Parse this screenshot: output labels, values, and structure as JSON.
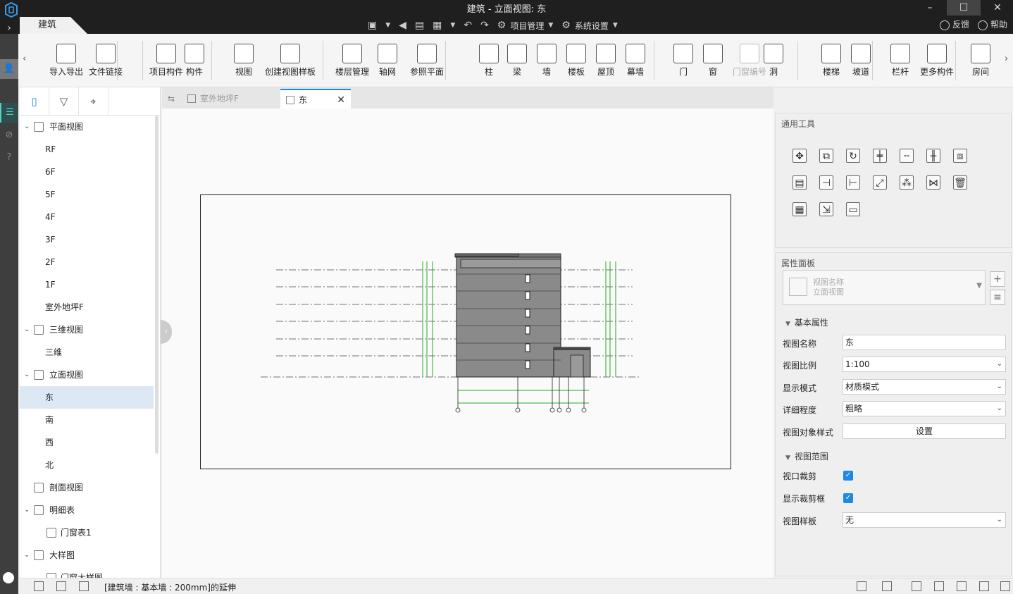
{
  "window": {
    "title": "建筑 - 立面视图: 东",
    "active_tab": "建筑",
    "controls": {
      "minimize": "–",
      "maximize": "☐",
      "close": "✕"
    }
  },
  "quick_access": {
    "project_mgmt": "项目管理",
    "system_settings": "系统设置",
    "feedback": "反馈",
    "help": "帮助"
  },
  "ribbon": {
    "items": [
      {
        "label": "导入导出",
        "icon": "cad-import-icon"
      },
      {
        "label": "文件链接",
        "icon": "file-link-icon"
      },
      {
        "label": "项目构件",
        "icon": "project-component-icon"
      },
      {
        "label": "构件",
        "icon": "component-icon"
      },
      {
        "label": "视图",
        "icon": "view-icon"
      },
      {
        "label": "创建视图样板",
        "icon": "view-template-icon"
      },
      {
        "label": "楼层管理",
        "icon": "floor-manage-icon"
      },
      {
        "label": "轴网",
        "icon": "grid-icon"
      },
      {
        "label": "参照平面",
        "icon": "ref-plane-icon"
      },
      {
        "label": "柱",
        "icon": "column-icon"
      },
      {
        "label": "梁",
        "icon": "beam-icon"
      },
      {
        "label": "墙",
        "icon": "wall-icon"
      },
      {
        "label": "楼板",
        "icon": "slab-icon"
      },
      {
        "label": "屋顶",
        "icon": "roof-icon"
      },
      {
        "label": "幕墙",
        "icon": "curtain-wall-icon"
      },
      {
        "label": "门",
        "icon": "door-icon"
      },
      {
        "label": "窗",
        "icon": "window-icon"
      },
      {
        "label": "门窗编号",
        "icon": "door-window-tag-icon"
      },
      {
        "label": "洞",
        "icon": "opening-icon"
      },
      {
        "label": "楼梯",
        "icon": "stair-icon"
      },
      {
        "label": "坡道",
        "icon": "ramp-icon"
      },
      {
        "label": "栏杆",
        "icon": "railing-icon"
      },
      {
        "label": "更多构件",
        "icon": "more-components-icon"
      },
      {
        "label": "房间",
        "icon": "room-icon"
      }
    ]
  },
  "tree": {
    "groups": [
      {
        "label": "平面视图",
        "children": [
          "RF",
          "6F",
          "5F",
          "4F",
          "3F",
          "2F",
          "1F",
          "室外地坪F"
        ]
      },
      {
        "label": "三维视图",
        "children": [
          "三维"
        ]
      },
      {
        "label": "立面视图",
        "children": [
          "东",
          "南",
          "西",
          "北"
        ],
        "selected": "东"
      },
      {
        "label": "剖面视图",
        "children": []
      },
      {
        "label": "明细表",
        "children": [
          "门窗表1"
        ]
      },
      {
        "label": "大样图",
        "children": [
          "门窗大样图"
        ]
      }
    ]
  },
  "doc_tabs": [
    {
      "label": "室外地坪F",
      "active": false
    },
    {
      "label": "东",
      "active": true
    }
  ],
  "properties": {
    "tools_title": "通用工具",
    "panel_title": "属性面板",
    "selector_line1": "视图名称",
    "selector_line2": "立面视图",
    "section_basic": "基本属性",
    "section_range": "视图范围",
    "view_name_label": "视图名称",
    "view_name_value": "东",
    "scale_label": "视图比例",
    "scale_value": "1:100",
    "display_mode_label": "显示模式",
    "display_mode_value": "材质模式",
    "detail_label": "详细程度",
    "detail_value": "粗略",
    "object_style_label": "视图对象样式",
    "object_style_button": "设置",
    "crop_label": "视口裁剪",
    "crop_checked": true,
    "show_crop_label": "显示裁剪框",
    "show_crop_checked": true,
    "template_label": "视图样板",
    "template_value": "无"
  },
  "status": {
    "message": "[建筑墙 : 基本墙 : 200mm]的延伸"
  },
  "colors": {
    "accent": "#1e88e5",
    "teal": "#4fd1c5",
    "building_fill": "#8a8a8a",
    "grid_green": "#22aa22"
  }
}
